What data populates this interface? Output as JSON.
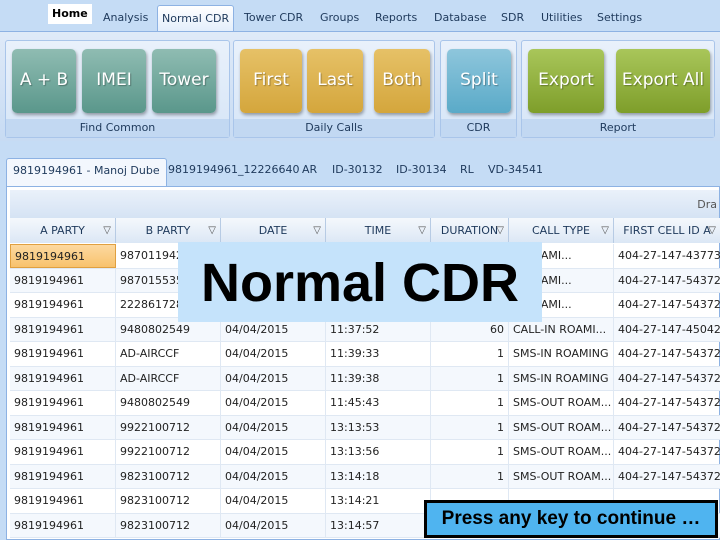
{
  "menu": {
    "tabs": [
      "Home",
      "Analysis",
      "Normal CDR",
      "Tower CDR",
      "Groups",
      "Reports",
      "Database",
      "SDR",
      "Utilities",
      "Settings"
    ],
    "active": "Normal CDR"
  },
  "ribbon": {
    "groups": [
      {
        "label": "Find Common",
        "buttons": [
          "A + B",
          "IMEI",
          "Tower"
        ]
      },
      {
        "label": "Daily Calls",
        "buttons": [
          "First",
          "Last",
          "Both"
        ]
      },
      {
        "label": "CDR",
        "buttons": [
          "Split"
        ]
      },
      {
        "label": "Report",
        "buttons": [
          "Export",
          "Export All"
        ]
      }
    ],
    "colors": {
      "find_common": "#6fa89c",
      "daily_calls": "#dcb04c",
      "cdr": "#6fb6d2",
      "report": "#93b23f"
    }
  },
  "doc_tabs": [
    "9819194961 - Manoj Dube",
    "9819194961_12226640",
    "AR",
    "ID-30132",
    "ID-30134",
    "RL",
    "VD-34541"
  ],
  "grid": {
    "group_hint": "Dra",
    "columns": [
      "A PARTY",
      "B PARTY",
      "DATE",
      "TIME",
      "DURATION",
      "CALL TYPE",
      "FIRST CELL ID A"
    ],
    "rows": [
      [
        "9819194961",
        "987011942",
        "",
        "",
        "",
        "N ROAMI...",
        "404-27-147-43773"
      ],
      [
        "9819194961",
        "987015535",
        "",
        "",
        "",
        "N ROAMI...",
        "404-27-147-54372"
      ],
      [
        "9819194961",
        "222861728",
        "",
        "",
        "",
        "N ROAMI...",
        "404-27-147-54372"
      ],
      [
        "9819194961",
        "9480802549",
        "04/04/2015",
        "11:37:52",
        "60",
        "CALL-IN ROAMI...",
        "404-27-147-45042"
      ],
      [
        "9819194961",
        "AD-AIRCCF",
        "04/04/2015",
        "11:39:33",
        "1",
        "SMS-IN ROAMING",
        "404-27-147-54372"
      ],
      [
        "9819194961",
        "AD-AIRCCF",
        "04/04/2015",
        "11:39:38",
        "1",
        "SMS-IN ROAMING",
        "404-27-147-54372"
      ],
      [
        "9819194961",
        "9480802549",
        "04/04/2015",
        "11:45:43",
        "1",
        "SMS-OUT ROAM...",
        "404-27-147-54372"
      ],
      [
        "9819194961",
        "9922100712",
        "04/04/2015",
        "13:13:53",
        "1",
        "SMS-OUT ROAM...",
        "404-27-147-54372"
      ],
      [
        "9819194961",
        "9922100712",
        "04/04/2015",
        "13:13:56",
        "1",
        "SMS-OUT ROAM...",
        "404-27-147-54372"
      ],
      [
        "9819194961",
        "9823100712",
        "04/04/2015",
        "13:14:18",
        "1",
        "SMS-OUT ROAM...",
        "404-27-147-54372"
      ],
      [
        "9819194961",
        "9823100712",
        "04/04/2015",
        "13:14:21",
        "",
        "",
        ""
      ],
      [
        "9819194961",
        "9823100712",
        "04/04/2015",
        "13:14:57",
        "",
        "",
        ""
      ]
    ]
  },
  "overlay_title": "Normal CDR",
  "press_prompt": "Press any key to continue …"
}
